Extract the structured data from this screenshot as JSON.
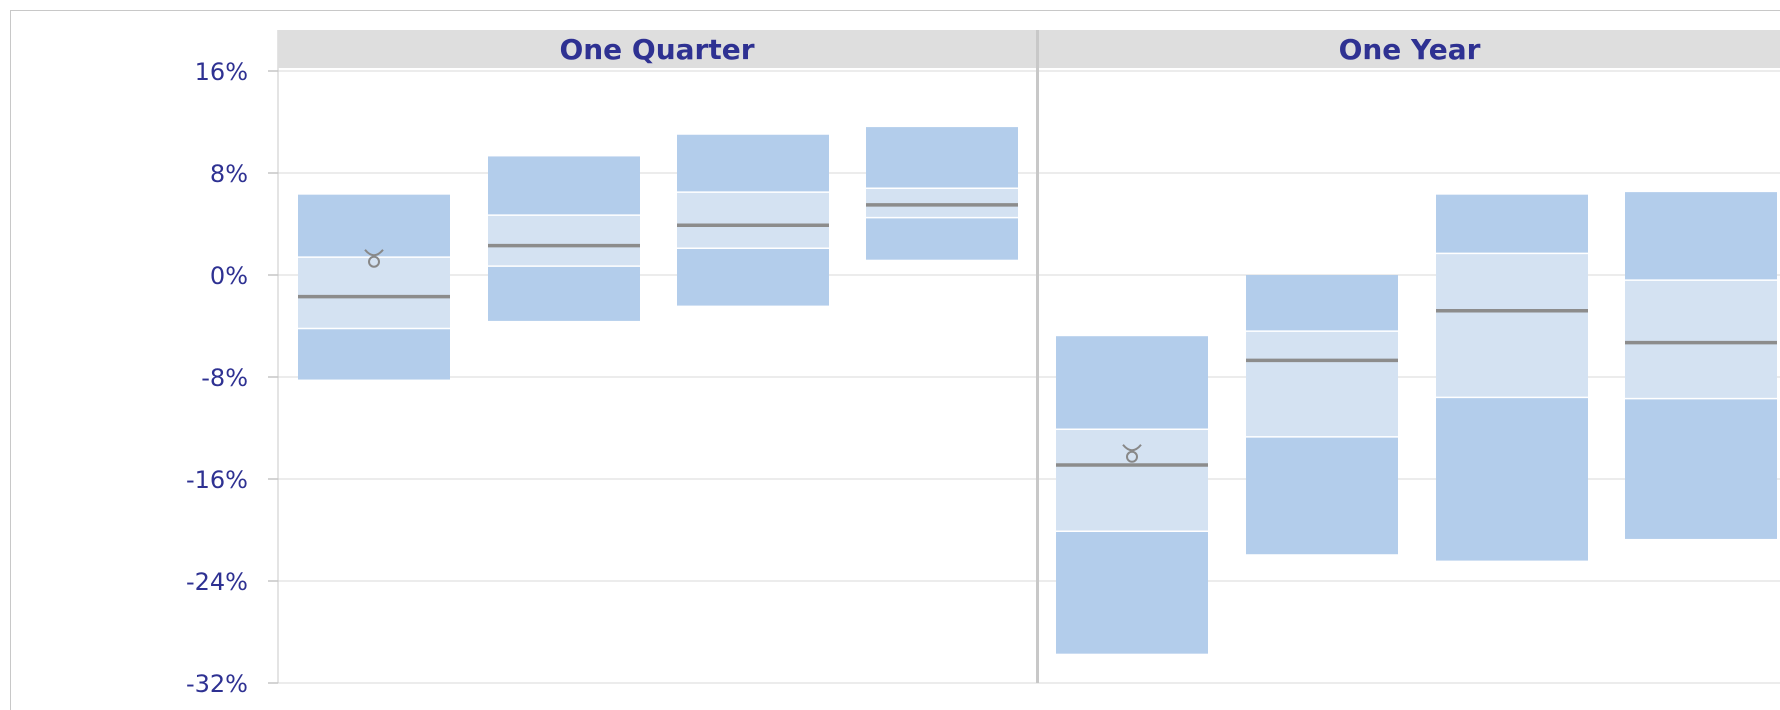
{
  "chart_data": {
    "type": "box",
    "y_tick_labels": [
      "16%",
      "8%",
      "0%",
      "-8%",
      "-16%",
      "-24%",
      "-32%"
    ],
    "y_ticks": [
      16,
      8,
      0,
      -8,
      -16,
      -24,
      -32
    ],
    "ylim": [
      -32,
      16
    ],
    "grid": true,
    "panels": [
      {
        "title": "One Quarter",
        "boxes": [
          {
            "p5": -8.2,
            "p25": -4.2,
            "median": -1.7,
            "p75": 1.4,
            "p95": 6.3,
            "marker": 1.2
          },
          {
            "p5": -3.6,
            "p25": 0.7,
            "median": 2.3,
            "p75": 4.7,
            "p95": 9.3,
            "marker": null
          },
          {
            "p5": -2.4,
            "p25": 2.1,
            "median": 3.9,
            "p75": 6.5,
            "p95": 11.0,
            "marker": null
          },
          {
            "p5": 1.2,
            "p25": 4.5,
            "median": 5.5,
            "p75": 6.8,
            "p95": 11.6,
            "marker": null
          }
        ]
      },
      {
        "title": "One Year",
        "boxes": [
          {
            "p5": -29.7,
            "p25": -20.1,
            "median": -14.9,
            "p75": -12.1,
            "p95": -4.8,
            "marker": -14.1
          },
          {
            "p5": -21.9,
            "p25": -12.7,
            "median": -6.7,
            "p75": -4.4,
            "p95": 0.0,
            "marker": null
          },
          {
            "p5": -22.4,
            "p25": -9.6,
            "median": -2.8,
            "p75": 1.7,
            "p95": 6.3,
            "marker": null
          },
          {
            "p5": -20.7,
            "p25": -9.7,
            "median": -5.3,
            "p75": -0.4,
            "p95": 6.5,
            "marker": null
          }
        ]
      }
    ],
    "colors": {
      "outer_band": "#b3cdeb",
      "inner_band": "#d4e2f2",
      "median": "#8c8c8c",
      "marker": "#888888",
      "grid": "#d9d9d9",
      "header_bg": "#dedede",
      "label": "#2e3192"
    }
  }
}
